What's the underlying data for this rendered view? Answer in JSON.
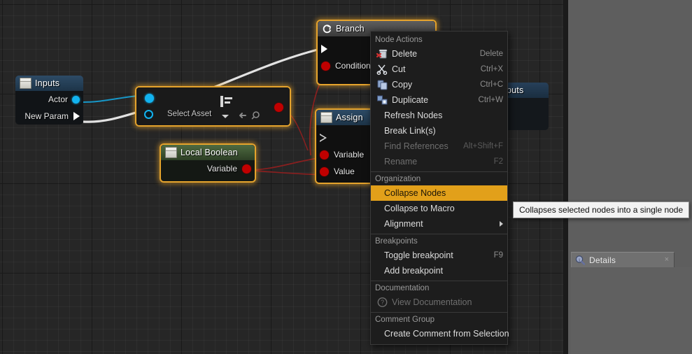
{
  "graph": {
    "nodes": [
      {
        "id": "inputs",
        "title": "Inputs",
        "icon": "variable-box-icon",
        "pins": [
          {
            "label": "Actor",
            "type": "object-blue"
          },
          {
            "label": "New Param",
            "type": "exec"
          }
        ]
      },
      {
        "id": "select-asset",
        "title": "",
        "value": "Select Asset",
        "icon": "asset-picker-icon",
        "browse_icon": "browse-arrow-icon",
        "find_icon": "magnifier-icon",
        "caret_icon": "chevron-down-icon"
      },
      {
        "id": "branch",
        "title": "Branch",
        "icon": "branch-icon",
        "pins": [
          {
            "label": "",
            "type": "exec-in"
          },
          {
            "label": "Condition",
            "type": "bool-red"
          }
        ]
      },
      {
        "id": "local-boolean",
        "title": "Local Boolean",
        "icon": "variable-box-icon",
        "pins": [
          {
            "label": "Variable",
            "type": "bool-red"
          }
        ]
      },
      {
        "id": "assign",
        "title": "Assign",
        "icon": "variable-box-icon",
        "pins": [
          {
            "label": "",
            "type": "exec-in"
          },
          {
            "label": "Variable",
            "type": "bool-red"
          },
          {
            "label": "Value",
            "type": "bool-red"
          }
        ]
      },
      {
        "id": "outputs",
        "title": "puts",
        "icon": "variable-box-icon"
      }
    ]
  },
  "context_menu": {
    "sections": [
      {
        "heading": "Node Actions",
        "items": [
          {
            "label": "Delete",
            "shortcut": "Delete",
            "icon": "delete-icon",
            "state": "normal"
          },
          {
            "label": "Cut",
            "shortcut": "Ctrl+X",
            "icon": "cut-icon",
            "state": "normal"
          },
          {
            "label": "Copy",
            "shortcut": "Ctrl+C",
            "icon": "copy-icon",
            "state": "normal"
          },
          {
            "label": "Duplicate",
            "shortcut": "Ctrl+W",
            "icon": "duplicate-icon",
            "state": "normal"
          },
          {
            "label": "Refresh Nodes",
            "shortcut": "",
            "icon": "",
            "state": "normal"
          },
          {
            "label": "Break Link(s)",
            "shortcut": "",
            "icon": "",
            "state": "normal"
          },
          {
            "label": "Find References",
            "shortcut": "Alt+Shift+F",
            "icon": "",
            "state": "disabled"
          },
          {
            "label": "Rename",
            "shortcut": "F2",
            "icon": "",
            "state": "disabled"
          }
        ]
      },
      {
        "heading": "Organization",
        "items": [
          {
            "label": "Collapse Nodes",
            "shortcut": "",
            "icon": "",
            "state": "highlighted"
          },
          {
            "label": "Collapse to Macro",
            "shortcut": "",
            "icon": "",
            "state": "normal"
          },
          {
            "label": "Alignment",
            "shortcut": "",
            "icon": "",
            "state": "submenu"
          }
        ]
      },
      {
        "heading": "Breakpoints",
        "items": [
          {
            "label": "Toggle breakpoint",
            "shortcut": "F9",
            "icon": "",
            "state": "normal"
          },
          {
            "label": "Add breakpoint",
            "shortcut": "",
            "icon": "",
            "state": "normal"
          }
        ]
      },
      {
        "heading": "Documentation",
        "items": [
          {
            "label": "View Documentation",
            "shortcut": "",
            "icon": "help-icon",
            "state": "disabled"
          }
        ]
      },
      {
        "heading": "Comment Group",
        "items": [
          {
            "label": "Create Comment from Selection",
            "shortcut": "",
            "icon": "",
            "state": "normal"
          }
        ]
      }
    ]
  },
  "tooltip": {
    "text": "Collapses selected nodes into a single node"
  },
  "details_panel": {
    "tab_label": "Details",
    "tab_icon": "details-magnifier-icon",
    "close_icon": "close-icon",
    "close_label": "×"
  },
  "colors": {
    "highlight": "#e2a01a",
    "selection_outline": "#e5a32c",
    "exec_wire": "#ffffff",
    "bool_wire": "#8c2020",
    "object_wire": "#12b3f0",
    "menu_background": "#1d1d1d",
    "canvas_background": "#262626",
    "panel_background": "#5e5e5e"
  }
}
